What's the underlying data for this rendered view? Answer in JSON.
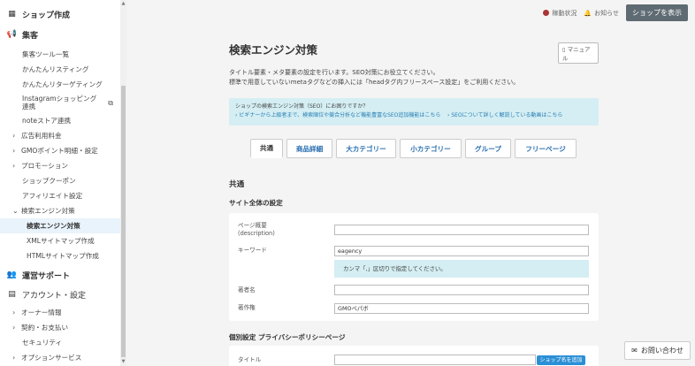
{
  "sidebar": {
    "shop_create": "ショップ作成",
    "attract": "集客",
    "attract_items": {
      "tools": "集客ツール一覧",
      "listing": "かんたんリスティング",
      "retargeting": "かんたんリターゲティング",
      "instagram": "Instagramショッピング連携",
      "note": "noteストア連携",
      "ads": "広告利用料金",
      "gmo_points": "GMOポイント明細・設定",
      "promotion": "プロモーション",
      "coupon": "ショップクーポン",
      "affiliate": "アフィリエイト設定",
      "seo": "検索エンジン対策",
      "seo_active": "検索エンジン対策",
      "xml_sitemap": "XMLサイトマップ作成",
      "html_sitemap": "HTMLサイトマップ作成"
    },
    "support": "運営サポート",
    "account": "アカウント・設定",
    "account_items": {
      "owner": "オーナー情報",
      "contract": "契約・お支払い",
      "security": "セキュリティ",
      "option": "オプションサービス"
    }
  },
  "topbar": {
    "status": "稼動状況",
    "notice": "お知らせ",
    "show_shop": "ショップを表示"
  },
  "page": {
    "title": "検索エンジン対策",
    "manual": "マニュアル",
    "desc1": "タイトル要素・メタ要素の設定を行います。SEO対策にお役立てください。",
    "desc2": "標準で用意していないmetaタグなどの挿入には「headタグ内フリースペース設定」をご利用ください。",
    "info_question": "ショップの検索エンジン対策（SEO）にお困りですか？",
    "info_link1": "ビギナーから上級者まで、検索順位や競合分析など機能豊富なSEO追加機能はこちら",
    "info_link2": "SEOについて詳しく解説している動画はこちら"
  },
  "tabs": [
    "共通",
    "商品詳細",
    "大カテゴリー",
    "小カテゴリー",
    "グループ",
    "フリーページ"
  ],
  "common": {
    "section": "共通",
    "site_settings": "サイト全体の設定",
    "desc_label1": "ページ概要",
    "desc_label2": "(description)",
    "desc_value": "",
    "keyword_label": "キーワード",
    "keyword_value": "eagency",
    "keyword_hint": "カンマ「,」区切りで指定してください。",
    "author_label": "著者名",
    "author_value": "",
    "copyright_label": "著作権",
    "copyright_value": "GMOペパボ"
  },
  "privacy": {
    "section": "個別設定 プライバシーポリシーページ",
    "title_label": "タイトル",
    "title_value": "",
    "insert_button": "ショップ名を追加"
  },
  "contact": "お問い合わせ"
}
